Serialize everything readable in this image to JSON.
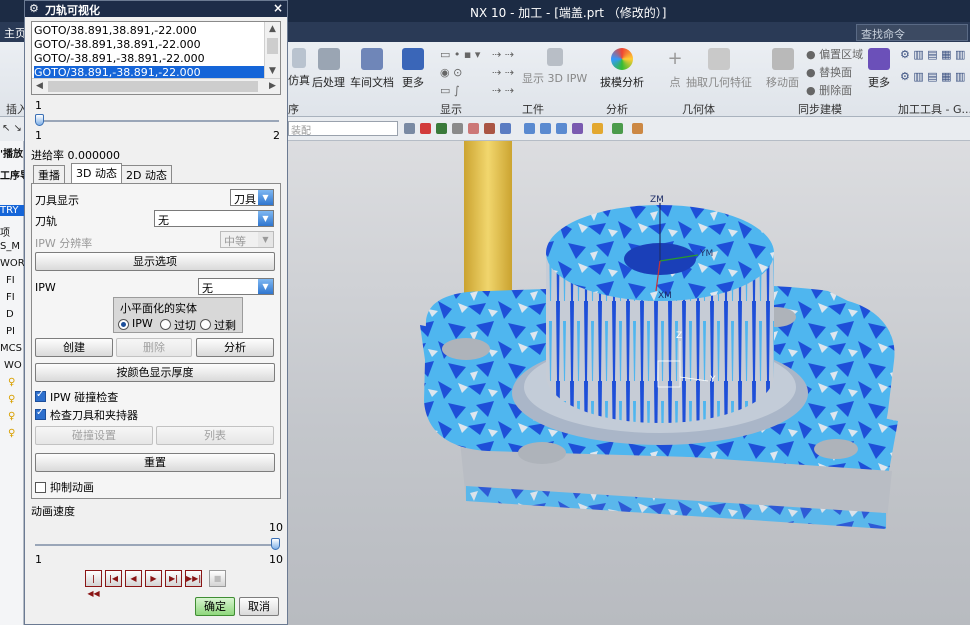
{
  "app": {
    "window_title": "NX 10 - 加工 - [端盖.prt （修改的）]"
  },
  "ribbon": {
    "tabs": [
      "主页"
    ],
    "search_placeholder": "查找命令",
    "buttons": [
      "仿真",
      "后处理",
      "车间文档",
      "更多",
      "显示 3D IPW",
      "拔模分析",
      "点",
      "抽取几何特征",
      "移动面",
      "更多"
    ],
    "small_buttons": [
      "偏置区域",
      "替换面",
      "删除面"
    ],
    "group_labels": [
      "显示",
      "工件",
      "分析",
      "几何体",
      "同步建模",
      "加工工具 - G..."
    ],
    "left_labels": [
      "插入",
      "序"
    ],
    "filter_placeholder": "装配"
  },
  "left_nav": {
    "items": [
      "工序导航器 - ",
      "'播放",
      "TRY",
      "项",
      "S_M",
      "WOR",
      "FI",
      "FI",
      "D",
      "PI",
      "MCS",
      "WO"
    ]
  },
  "dialog": {
    "title": "刀轨可视化",
    "close": "×",
    "goto_rows": [
      "GOTO/38.891,38.891,-22.000",
      "GOTO/-38.891,38.891,-22.000",
      "GOTO/-38.891,-38.891,-22.000",
      "GOTO/38.891,-38.891,-22.000"
    ],
    "slider_value": "1",
    "slider_min": "1",
    "slider_max": "2",
    "feed_rate": "进给率 0.000000",
    "tabs": [
      "重播",
      "3D 动态",
      "2D 动态"
    ],
    "active_tab": "3D 动态",
    "tool_display_label": "刀具显示",
    "tool_display_value": "刀具",
    "toolpath_label": "刀轨",
    "toolpath_value": "无",
    "ipw_resolution_label": "IPW 分辨率",
    "ipw_resolution_value": "中等",
    "display_options_button": "显示选项",
    "ipw_label": "IPW",
    "ipw_value": "无",
    "facet_title": "小平面化的实体",
    "facet_options": [
      "IPW",
      "过切",
      "过剩"
    ],
    "create_button": "创建",
    "delete_button": "删除",
    "analyze_button": "分析",
    "color_thickness_button": "按颜色显示厚度",
    "ipw_collision_check": "IPW 碰撞检查",
    "check_tool_holder": "检查刀具和夹持器",
    "collision_settings_button": "碰撞设置",
    "list_button": "列表",
    "reset_button": "重置",
    "suppress_animation": "抑制动画",
    "animation_speed_label": "动画速度",
    "speed_value": "10",
    "speed_min": "1",
    "speed_max": "10",
    "speed_level": 1.0,
    "ok_button": "确定",
    "cancel_button": "取消"
  },
  "viewport": {
    "axis_labels": [
      "ZM",
      "YM",
      "XM",
      "Z",
      "Y"
    ],
    "colors": {
      "stock_light": "#4fb6ef",
      "stock_dark": "#1e4fd8",
      "part_gray": "#c8c8c8",
      "tool": "#e8b427"
    }
  }
}
